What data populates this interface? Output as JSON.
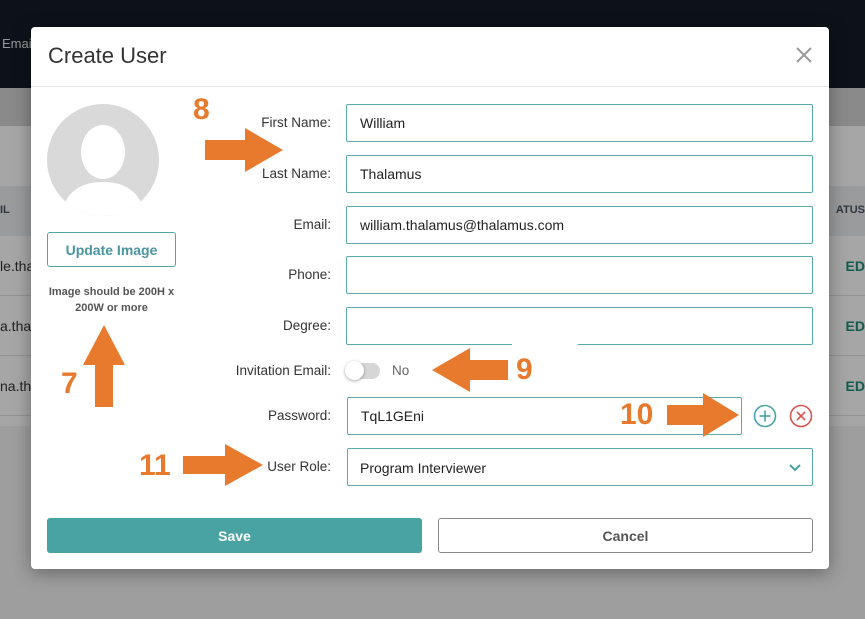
{
  "background": {
    "header_text": "Emai",
    "table_header_left": "IL",
    "table_header_right": "ATUS",
    "rows": [
      {
        "left": "le.tha",
        "right": "ED"
      },
      {
        "left": "a.thal",
        "right": "ED"
      },
      {
        "left": "na.tha",
        "right": "ED"
      }
    ]
  },
  "modal": {
    "title": "Create User",
    "update_image_label": "Update Image",
    "image_hint": "Image should be 200H x 200W or more",
    "fields": {
      "first_name": {
        "label": "First Name:",
        "value": "William"
      },
      "last_name": {
        "label": "Last Name:",
        "value": "Thalamus"
      },
      "email": {
        "label": "Email:",
        "value": "william.thalamus@thalamus.com"
      },
      "phone": {
        "label": "Phone:",
        "value": ""
      },
      "degree": {
        "label": "Degree:",
        "value": ""
      },
      "invitation_email": {
        "label": "Invitation Email:",
        "toggle_text": "No"
      },
      "password": {
        "label": "Password:",
        "value": "TqL1GEni"
      },
      "user_role": {
        "label": "User Role:",
        "value": "Program Interviewer"
      }
    },
    "save_label": "Save",
    "cancel_label": "Cancel"
  },
  "annotations": {
    "n7": "7",
    "n8": "8",
    "n9": "9",
    "n10": "10",
    "n11": "11",
    "color": "#e87a2e"
  },
  "colors": {
    "accent": "#4aa3a3",
    "input_border": "#5aa9ad",
    "remove_red": "#d9534f"
  }
}
